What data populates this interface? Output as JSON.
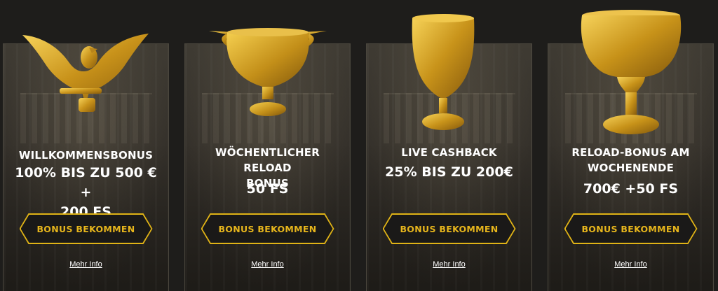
{
  "colors": {
    "accent": "#e0b316",
    "background": "#1e1d1b",
    "gold": "#d4a21a"
  },
  "cards": [
    {
      "trophy_icon": "golden-eagle-icon",
      "title_lines": [
        "WILLKOMMENSBONUS"
      ],
      "amount_lines": [
        "100% BIS ZU 500 € +",
        "200 FS"
      ],
      "button_label": "BONUS BEKOMMEN",
      "more_label": "Mehr Info"
    },
    {
      "trophy_icon": "golden-cup-handles-icon",
      "title_lines": [
        "WÖCHENTLICHER RELOAD",
        "BONUS"
      ],
      "amount_lines": [
        "50 FS"
      ],
      "button_label": "BONUS BEKOMMEN",
      "more_label": "Mehr Info"
    },
    {
      "trophy_icon": "golden-goblet-icon",
      "title_lines": [
        "LIVE CASHBACK"
      ],
      "amount_lines": [
        "25% BIS ZU 200€"
      ],
      "button_label": "BONUS BEKOMMEN",
      "more_label": "Mehr Info"
    },
    {
      "trophy_icon": "golden-chalice-icon",
      "title_lines": [
        "RELOAD-BONUS AM",
        "WOCHENENDE"
      ],
      "amount_lines": [
        "700€ +50 FS"
      ],
      "button_label": "BONUS BEKOMMEN",
      "more_label": "Mehr Info"
    }
  ]
}
